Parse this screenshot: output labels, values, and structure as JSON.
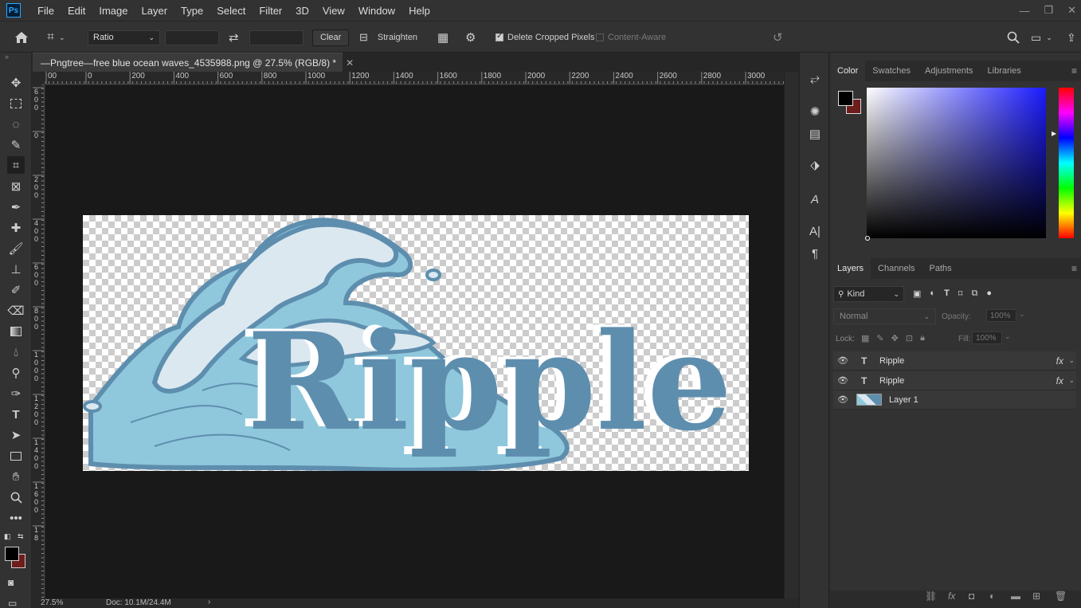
{
  "app": {
    "logo": "Ps",
    "menu": [
      "File",
      "Edit",
      "Image",
      "Layer",
      "Type",
      "Select",
      "Filter",
      "3D",
      "View",
      "Window",
      "Help"
    ],
    "window_controls": [
      "minimize",
      "restore",
      "close"
    ]
  },
  "options": {
    "ratio_label": "Ratio",
    "width_value": "",
    "height_value": "",
    "clear_label": "Clear",
    "straighten_label": "Straighten",
    "delete_cropped_label": "Delete Cropped Pixels",
    "delete_cropped_checked": true,
    "content_aware_label": "Content-Aware",
    "content_aware_checked": false
  },
  "document": {
    "tab_title": "—Pngtree—free blue ocean waves_4535988.png @ 27.5% (RGB/8) *",
    "ruler_top": [
      "00",
      "0",
      "200",
      "400",
      "600",
      "800",
      "1000",
      "1200",
      "1400",
      "1600",
      "1800",
      "2000",
      "2200",
      "2400",
      "2600",
      "2800",
      "3000"
    ],
    "ruler_left": [
      [
        "6",
        "0",
        "0"
      ],
      [
        "0"
      ],
      [
        "2",
        "0",
        "0"
      ],
      [
        "4",
        "0",
        "0"
      ],
      [
        "6",
        "0",
        "0"
      ],
      [
        "8",
        "0",
        "0"
      ],
      [
        "1",
        "0",
        "0",
        "0"
      ],
      [
        "1",
        "2",
        "0",
        "0"
      ],
      [
        "1",
        "4",
        "0",
        "0"
      ],
      [
        "1",
        "6",
        "0",
        "0"
      ],
      [
        "1",
        "8"
      ]
    ],
    "canvas_text": "Ripple",
    "zoom": "27.5%",
    "doc_size": "Doc: 10.1M/24.4M"
  },
  "colors": {
    "foreground": "#000000",
    "background": "#6e1c1c",
    "wave_dark": "#5e8eae",
    "wave_light": "#8fc8dc",
    "foam": "#dbe8f0"
  },
  "color_panel": {
    "tabs": [
      "Color",
      "Swatches",
      "Adjustments",
      "Libraries"
    ],
    "active_tab": "Color"
  },
  "layers_panel": {
    "tabs": [
      "Layers",
      "Channels",
      "Paths"
    ],
    "active_tab": "Layers",
    "filter_kind": "Kind",
    "blend_mode": "Normal",
    "opacity_label": "Opacity:",
    "opacity_value": "100%",
    "lock_label": "Lock:",
    "fill_label": "Fill:",
    "fill_value": "100%",
    "layers": [
      {
        "name": "Ripple",
        "kind": "text",
        "fx": "fx"
      },
      {
        "name": "Ripple",
        "kind": "text",
        "fx": "fx"
      },
      {
        "name": "Layer 1",
        "kind": "image",
        "fx": ""
      }
    ]
  },
  "icons": {
    "toolbar": [
      "move-icon",
      "marquee-icon",
      "lasso-icon",
      "quick-select-icon",
      "crop-icon",
      "frame-icon",
      "eyedropper-icon",
      "healing-icon",
      "brush-icon",
      "stamp-icon",
      "history-brush-icon",
      "eraser-icon",
      "gradient-icon",
      "blur-icon",
      "dodge-icon",
      "pen-icon",
      "type-icon",
      "path-select-icon",
      "rectangle-icon",
      "hand-icon",
      "zoom-icon",
      "more-icon"
    ],
    "side_panel": [
      "history-icon",
      "brush-settings-icon",
      "swatches-grid-icon",
      "3d-icon",
      "glyphs-icon",
      "character-icon",
      "paragraph-icon"
    ]
  }
}
